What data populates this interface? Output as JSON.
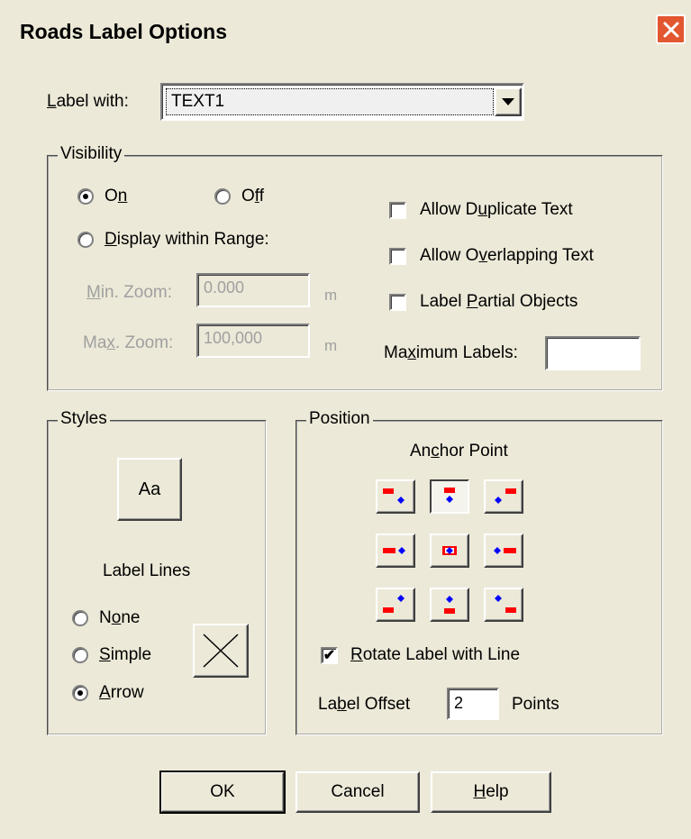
{
  "window": {
    "title": "Roads Label Options",
    "close_label": "✕"
  },
  "label_with": {
    "label_pre": "",
    "label_u": "L",
    "label_post": "abel with:",
    "value": "TEXT1"
  },
  "visibility": {
    "legend": "Visibility",
    "on": {
      "pre": "O",
      "u": "n",
      "post": "",
      "selected": true
    },
    "off": {
      "pre": "O",
      "u": "f",
      "post": "f",
      "selected": false
    },
    "range": {
      "pre": "",
      "u": "D",
      "post": "isplay within Range:",
      "selected": false
    },
    "min_zoom": {
      "pre": "",
      "u": "M",
      "post": "in. Zoom:",
      "value": "0.000",
      "unit": "m"
    },
    "max_zoom": {
      "pre": "Ma",
      "u": "x",
      "post": ". Zoom:",
      "value": "100,000",
      "unit": "m"
    },
    "allow_duplicate": {
      "pre": "Allow D",
      "u": "u",
      "post": "plicate Text",
      "checked": false
    },
    "allow_overlapping": {
      "pre": "Allow O",
      "u": "v",
      "post": "erlapping Text",
      "checked": false
    },
    "label_partial": {
      "pre": "Label ",
      "u": "P",
      "post": "artial Objects",
      "checked": false
    },
    "max_labels": {
      "pre": "Ma",
      "u": "x",
      "post": "imum Labels:",
      "value": ""
    }
  },
  "styles": {
    "legend": "Styles",
    "font_button": "Aa",
    "label_lines_title": "Label Lines",
    "none": {
      "pre": "N",
      "u": "o",
      "post": "ne",
      "selected": false
    },
    "simple": {
      "pre": "",
      "u": "S",
      "post": "imple",
      "selected": false
    },
    "arrow": {
      "pre": "",
      "u": "A",
      "post": "rrow",
      "selected": true
    }
  },
  "position": {
    "legend": "Position",
    "anchor_title": {
      "pre": "An",
      "u": "c",
      "post": "hor Point"
    },
    "selected_anchor": "top-center",
    "rotate": {
      "pre": "",
      "u": "R",
      "post": "otate Label with Line",
      "checked": true
    },
    "offset": {
      "pre": "La",
      "u": "b",
      "post": "el Offset",
      "value": "2",
      "unit": "Points"
    }
  },
  "buttons": {
    "ok": "OK",
    "cancel": "Cancel",
    "help_pre": "",
    "help_u": "H",
    "help_post": "elp"
  },
  "colors": {
    "marker_red": "#ff0000",
    "marker_blue": "#0000ff",
    "close_red": "#e2572f"
  }
}
